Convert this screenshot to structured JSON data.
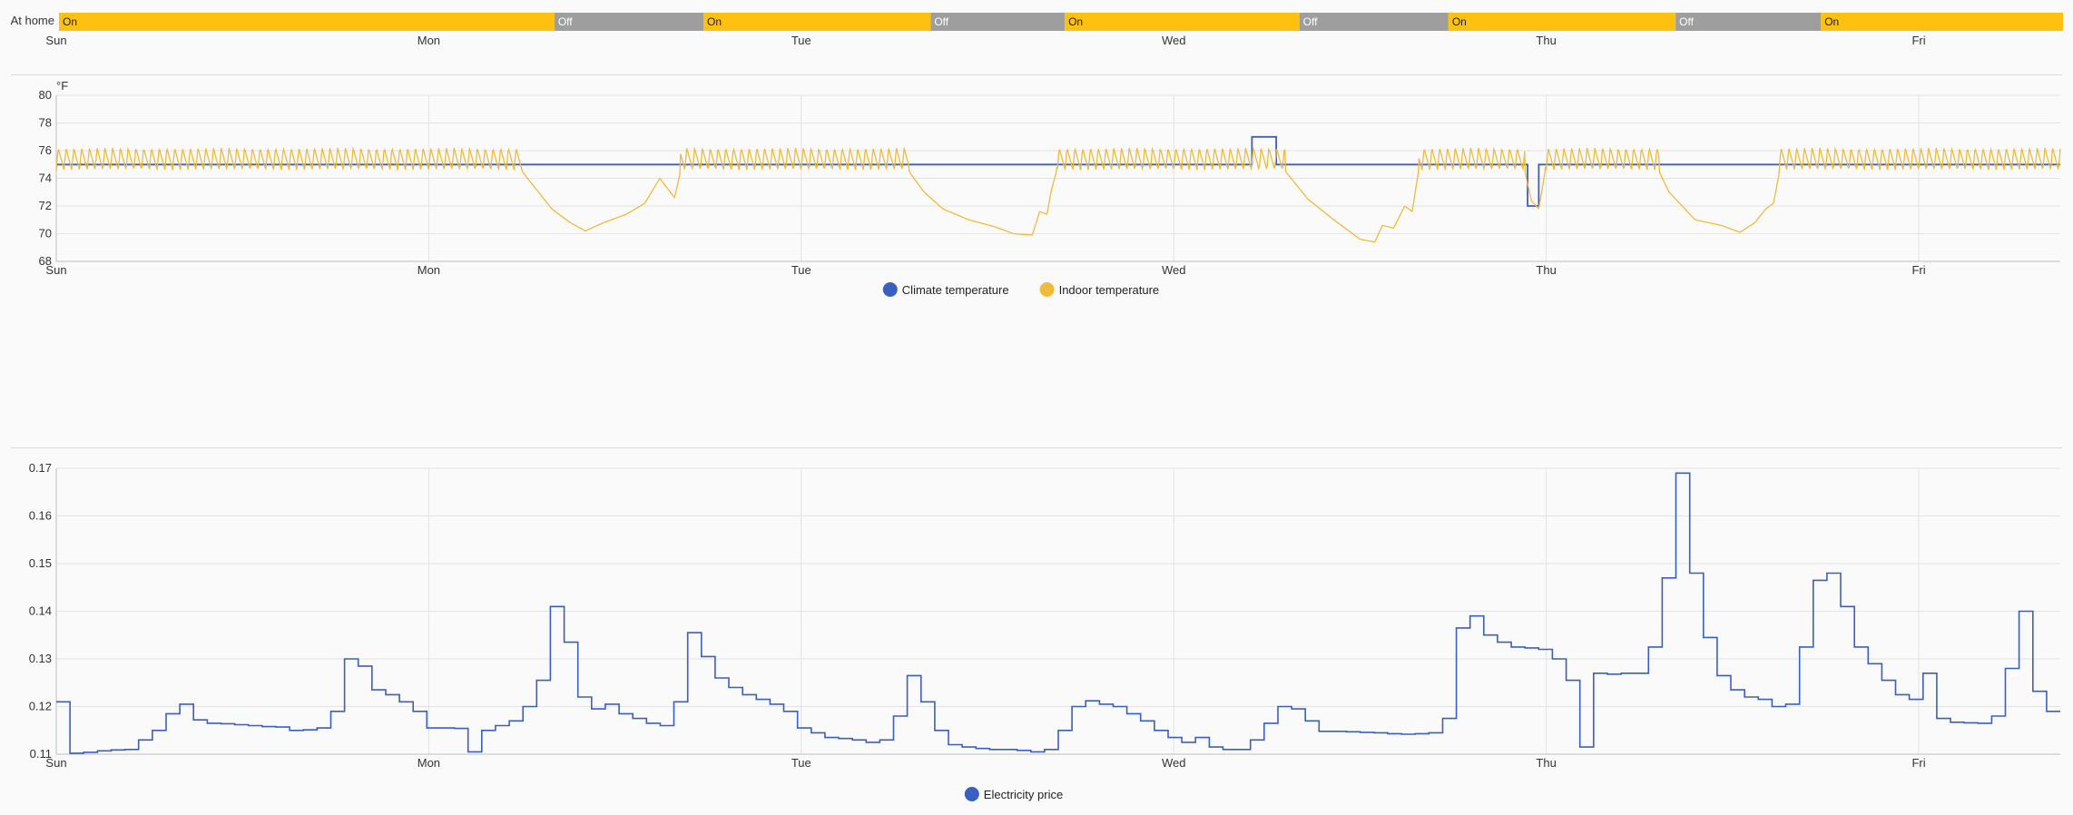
{
  "colors": {
    "on": "#fec110",
    "off": "#9e9e9e",
    "climate": "#3b5fc0",
    "indoor": "#f0bb3a",
    "price": "#3b5fc0",
    "grid": "#e3e3e3"
  },
  "timeline": {
    "label": "At home",
    "day_labels": [
      "Sun",
      "Mon",
      "Tue",
      "Wed",
      "Thu",
      "Fri"
    ],
    "segments": [
      {
        "state": "On",
        "start": 0.0,
        "end": 1.33
      },
      {
        "state": "Off",
        "start": 1.33,
        "end": 1.73
      },
      {
        "state": "On",
        "start": 1.73,
        "end": 2.34
      },
      {
        "state": "Off",
        "start": 2.34,
        "end": 2.7
      },
      {
        "state": "On",
        "start": 2.7,
        "end": 3.33
      },
      {
        "state": "Off",
        "start": 3.33,
        "end": 3.73
      },
      {
        "state": "On",
        "start": 3.73,
        "end": 4.34
      },
      {
        "state": "Off",
        "start": 4.34,
        "end": 4.73
      },
      {
        "state": "On",
        "start": 4.73,
        "end": 5.38
      }
    ]
  },
  "chart_data": [
    {
      "type": "line",
      "unit": "°F",
      "ylim": [
        68,
        80
      ],
      "yticks": [
        68,
        70,
        72,
        74,
        76,
        78,
        80
      ],
      "xlim": [
        0,
        5.38
      ],
      "x_tick_labels": [
        "Sun",
        "Mon",
        "Tue",
        "Wed",
        "Thu",
        "Fri"
      ],
      "grid": true,
      "legend_position": "bottom-center",
      "series": [
        {
          "name": "Climate temperature",
          "step": true,
          "points": [
            [
              0,
              75
            ],
            [
              3.21,
              75
            ],
            [
              3.21,
              77
            ],
            [
              3.275,
              77
            ],
            [
              3.275,
              75
            ],
            [
              3.95,
              75
            ],
            [
              3.95,
              72
            ],
            [
              3.98,
              72
            ],
            [
              3.98,
              75
            ],
            [
              5.38,
              75
            ]
          ]
        },
        {
          "name": "Indoor temperature",
          "oscillation_amplitude": 1.6,
          "base_low": 74.6,
          "periods_per_day": 48,
          "points": [
            [
              0,
              74.8
            ],
            [
              1.23,
              75.2
            ],
            [
              1.28,
              73.5
            ],
            [
              1.33,
              71.8
            ],
            [
              1.38,
              70.8
            ],
            [
              1.42,
              70.2
            ],
            [
              1.47,
              70.8
            ],
            [
              1.53,
              71.4
            ],
            [
              1.58,
              72.2
            ],
            [
              1.62,
              74.0
            ],
            [
              1.66,
              72.6
            ],
            [
              1.68,
              75.0
            ],
            [
              2.27,
              75.2
            ],
            [
              2.33,
              73.0
            ],
            [
              2.38,
              71.8
            ],
            [
              2.45,
              71.0
            ],
            [
              2.52,
              70.5
            ],
            [
              2.57,
              70.0
            ],
            [
              2.62,
              69.9
            ],
            [
              2.64,
              71.6
            ],
            [
              2.66,
              71.4
            ],
            [
              2.67,
              73.0
            ],
            [
              2.69,
              75.0
            ],
            [
              3.2,
              75.2
            ],
            [
              3.21,
              76.0
            ],
            [
              3.27,
              76.2
            ],
            [
              3.3,
              74.5
            ],
            [
              3.36,
              72.5
            ],
            [
              3.43,
              71.0
            ],
            [
              3.5,
              69.6
            ],
            [
              3.54,
              69.4
            ],
            [
              3.56,
              70.6
            ],
            [
              3.59,
              70.4
            ],
            [
              3.62,
              72.0
            ],
            [
              3.64,
              71.6
            ],
            [
              3.66,
              75.0
            ],
            [
              3.94,
              74.8
            ],
            [
              3.96,
              72.4
            ],
            [
              3.98,
              71.8
            ],
            [
              4.0,
              75.0
            ],
            [
              4.29,
              75.2
            ],
            [
              4.33,
              73.0
            ],
            [
              4.4,
              71.0
            ],
            [
              4.47,
              70.6
            ],
            [
              4.52,
              70.1
            ],
            [
              4.56,
              70.8
            ],
            [
              4.59,
              71.8
            ],
            [
              4.61,
              72.2
            ],
            [
              4.63,
              75.0
            ],
            [
              5.38,
              75.2
            ]
          ]
        }
      ]
    },
    {
      "type": "line",
      "ylim": [
        0.11,
        0.17
      ],
      "yticks": [
        0.11,
        0.12,
        0.13,
        0.14,
        0.15,
        0.16,
        0.17
      ],
      "xlim": [
        0,
        5.38
      ],
      "x_tick_labels": [
        "Sun",
        "Mon",
        "Tue",
        "Wed",
        "Thu",
        "Fri"
      ],
      "grid": true,
      "legend_position": "bottom-center",
      "series": [
        {
          "name": "Electricity price",
          "step": true,
          "values": [
            0.121,
            0.1102,
            0.1104,
            0.1107,
            0.1109,
            0.111,
            0.113,
            0.115,
            0.1185,
            0.1205,
            0.1172,
            0.1165,
            0.1164,
            0.1162,
            0.116,
            0.1158,
            0.1157,
            0.115,
            0.1151,
            0.1155,
            0.119,
            0.13,
            0.1285,
            0.1235,
            0.1225,
            0.121,
            0.119,
            0.1155,
            0.1155,
            0.1154,
            0.1105,
            0.115,
            0.116,
            0.117,
            0.12,
            0.1255,
            0.141,
            0.1335,
            0.122,
            0.1195,
            0.1205,
            0.1185,
            0.1175,
            0.1165,
            0.116,
            0.121,
            0.1355,
            0.1305,
            0.126,
            0.124,
            0.1225,
            0.1215,
            0.1205,
            0.119,
            0.1155,
            0.1145,
            0.1135,
            0.1133,
            0.113,
            0.1125,
            0.113,
            0.118,
            0.1265,
            0.121,
            0.115,
            0.112,
            0.1115,
            0.1112,
            0.111,
            0.111,
            0.1108,
            0.1105,
            0.111,
            0.115,
            0.12,
            0.1212,
            0.1205,
            0.12,
            0.1185,
            0.117,
            0.115,
            0.1135,
            0.1125,
            0.1135,
            0.1115,
            0.111,
            0.111,
            0.113,
            0.1165,
            0.12,
            0.1195,
            0.117,
            0.1148,
            0.1148,
            0.1147,
            0.1146,
            0.1145,
            0.1143,
            0.1142,
            0.1143,
            0.1145,
            0.1175,
            0.1365,
            0.139,
            0.135,
            0.1335,
            0.1325,
            0.1323,
            0.132,
            0.13,
            0.1255,
            0.1115,
            0.127,
            0.1268,
            0.127,
            0.127,
            0.1325,
            0.147,
            0.169,
            0.148,
            0.1345,
            0.1265,
            0.1235,
            0.122,
            0.1215,
            0.12,
            0.1205,
            0.1325,
            0.1465,
            0.148,
            0.141,
            0.1325,
            0.129,
            0.1255,
            0.1225,
            0.1215,
            0.127,
            0.1175,
            0.1167,
            0.1166,
            0.1165,
            0.118,
            0.128,
            0.14,
            0.1232,
            0.119
          ]
        }
      ]
    }
  ]
}
